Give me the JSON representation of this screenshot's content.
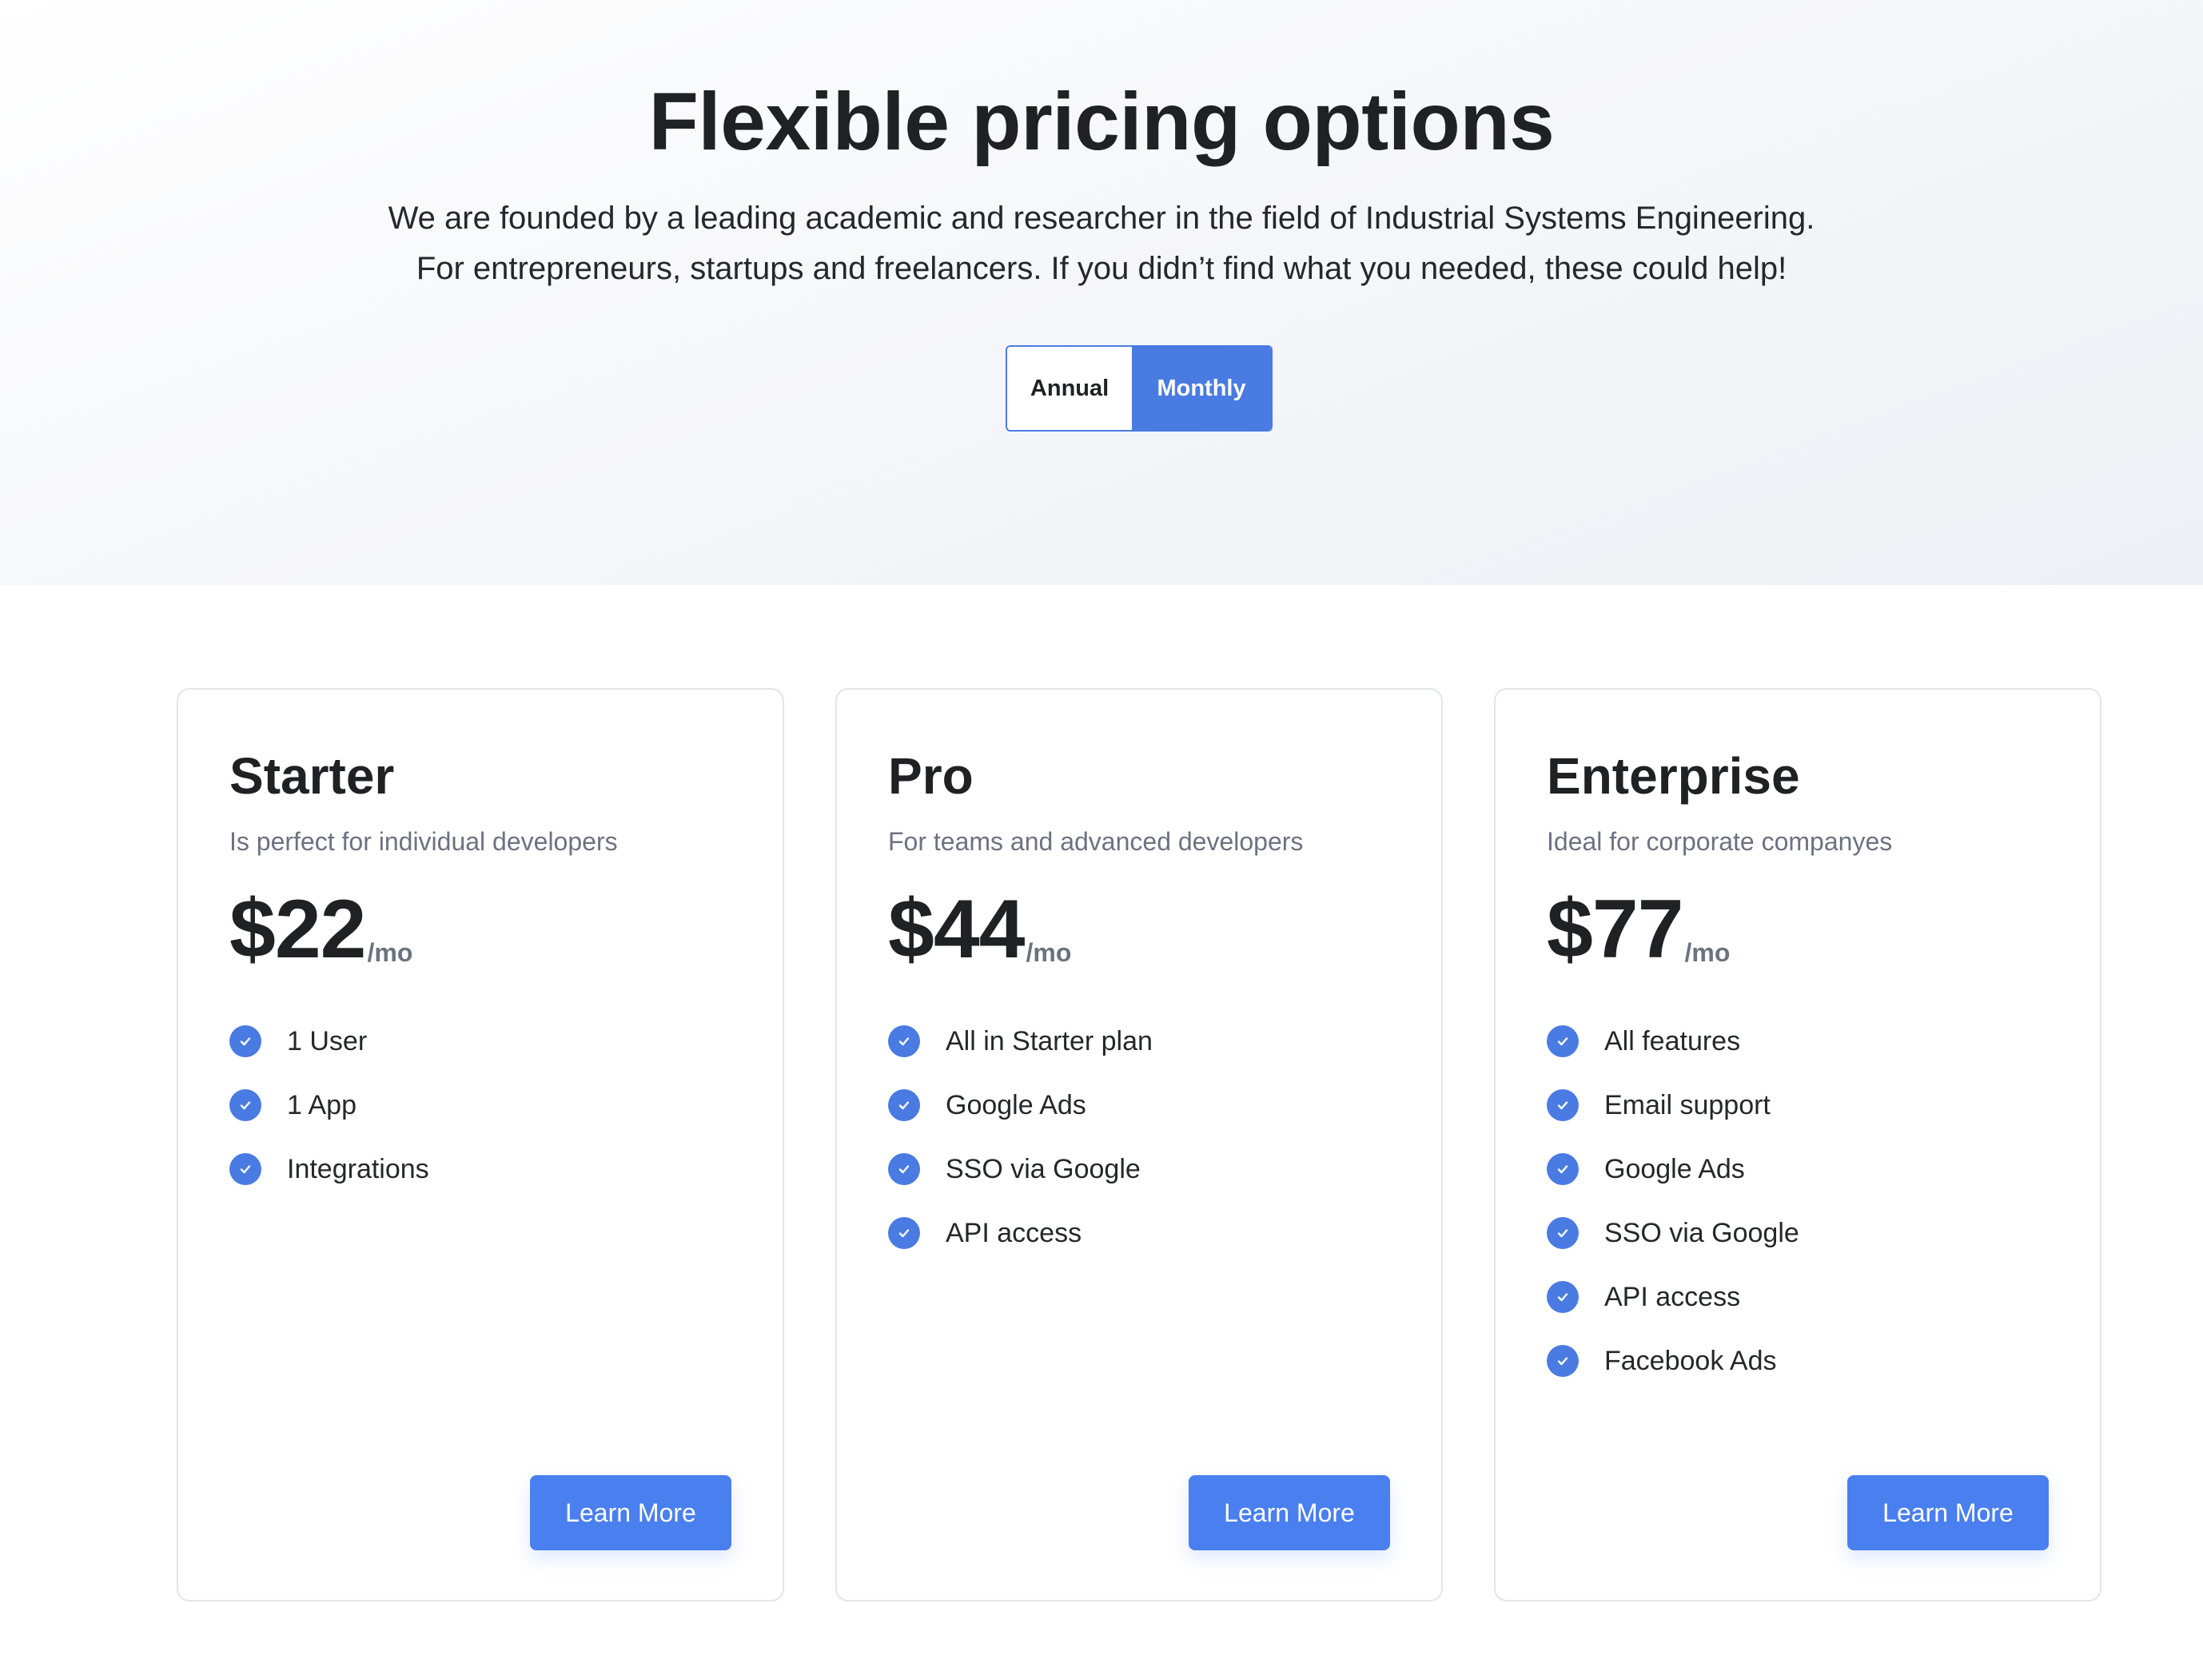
{
  "hero": {
    "title": "Flexible pricing options",
    "subtitle_line1": "We are founded by a leading academic and researcher in the field of Industrial Systems Engineering.",
    "subtitle_line2": "For entrepreneurs, startups and freelancers. If you didn’t find what you needed, these could help!"
  },
  "billing_toggle": {
    "annual_label": "Annual",
    "monthly_label": "Monthly",
    "selected": "Monthly"
  },
  "colors": {
    "accent": "#4a7be2",
    "button": "#4a7fef",
    "text": "#1f2124",
    "muted": "#6b7280"
  },
  "plans": [
    {
      "name": "Starter",
      "description": "Is perfect for individual developers",
      "price": "$22",
      "period": "/mo",
      "features": [
        "1 User",
        "1 App",
        "Integrations"
      ],
      "cta": "Learn More"
    },
    {
      "name": "Pro",
      "description": "For teams and advanced developers",
      "price": "$44",
      "period": "/mo",
      "features": [
        "All in Starter plan",
        "Google Ads",
        "SSO via Google",
        "API access"
      ],
      "cta": "Learn More"
    },
    {
      "name": "Enterprise",
      "description": "Ideal for corporate companyes",
      "price": "$77",
      "period": "/mo",
      "features": [
        "All features",
        "Email support",
        "Google Ads",
        "SSO via Google",
        "API access",
        "Facebook Ads"
      ],
      "cta": "Learn More"
    }
  ],
  "icons": {
    "feature_icon": "check-circle-icon"
  }
}
